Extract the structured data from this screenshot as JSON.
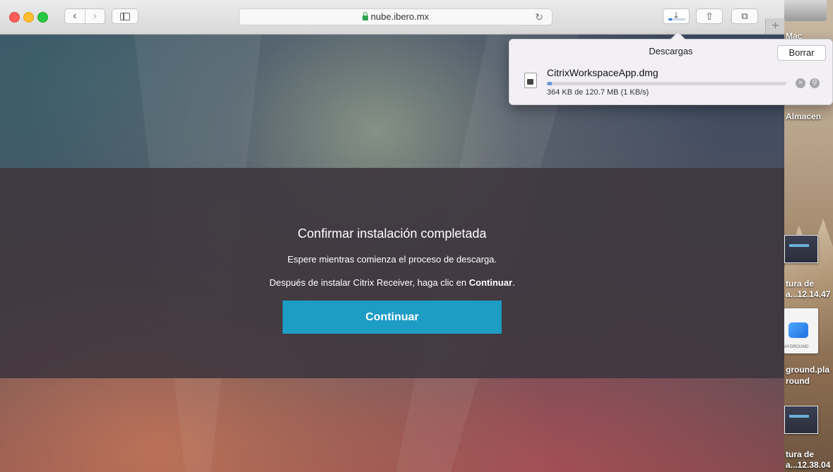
{
  "browser": {
    "url": "nube.ibero.mx",
    "download_progress": 0.003
  },
  "downloads": {
    "title": "Descargas",
    "clear_label": "Borrar",
    "item": {
      "filename": "CitrixWorkspaceApp.dmg",
      "status": "364 KB de 120.7 MB (1 KB/s)",
      "progress": 0.003
    }
  },
  "modal": {
    "title": "Confirmar instalación completada",
    "line1": "Espere mientras comienza el proceso de descarga.",
    "line2_prefix": "Después de instalar Citrix Receiver, haga clic en ",
    "line2_bold": "Continuar",
    "line2_suffix": ".",
    "button_label": "Continuar"
  },
  "desktop": {
    "labels": [
      "Mac",
      "Almacen",
      "tura de",
      "a...12.14.47",
      "ground.pla",
      "round",
      "tura de",
      "a...12.38.04"
    ],
    "file_caption": "AYGROUND"
  },
  "colors": {
    "continue_button": "#1d9cc4",
    "lock": "#2da44e"
  }
}
